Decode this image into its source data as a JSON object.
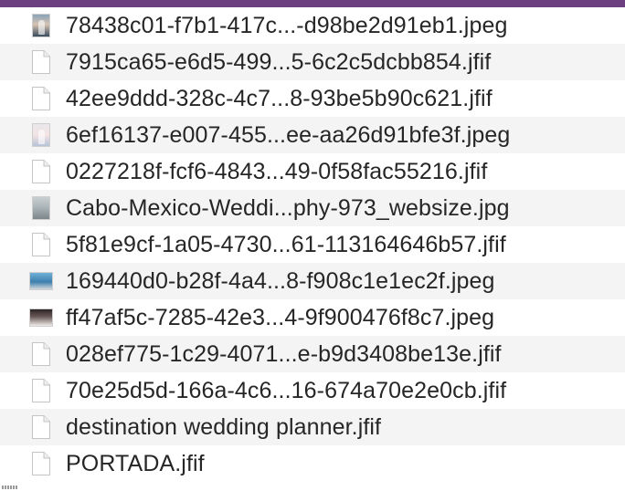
{
  "files": [
    {
      "name": "78438c01-f7b1-417c...-d98be2d91eb1.jpeg",
      "icon": "image-thumbnail-icon",
      "thumb": "t1",
      "alt": false
    },
    {
      "name": "7915ca65-e6d5-499...5-6c2c5dcbb854.jfif",
      "icon": "document-icon",
      "alt": true
    },
    {
      "name": "42ee9ddd-328c-4c7...8-93be5b90c621.jfif",
      "icon": "document-icon",
      "alt": false
    },
    {
      "name": "6ef16137-e007-455...ee-aa26d91bfe3f.jpeg",
      "icon": "image-thumbnail-icon",
      "thumb": "t2",
      "alt": true
    },
    {
      "name": "0227218f-fcf6-4843...49-0f58fac55216.jfif",
      "icon": "document-icon",
      "alt": false
    },
    {
      "name": "Cabo-Mexico-Weddi...phy-973_websize.jpg",
      "icon": "image-thumbnail-icon",
      "thumb": "t3",
      "alt": true
    },
    {
      "name": "5f81e9cf-1a05-4730...61-113164646b57.jfif",
      "icon": "document-icon",
      "alt": false
    },
    {
      "name": "169440d0-b28f-4a4...8-f908c1e1ec2f.jpeg",
      "icon": "image-thumbnail-icon",
      "thumb": "t4",
      "wide": true,
      "alt": true
    },
    {
      "name": "ff47af5c-7285-42e3...4-9f900476f8c7.jpeg",
      "icon": "image-thumbnail-icon",
      "thumb": "t5",
      "wide": true,
      "alt": false
    },
    {
      "name": "028ef775-1c29-4071...e-b9d3408be13e.jfif",
      "icon": "document-icon",
      "alt": true
    },
    {
      "name": "70e25d5d-166a-4c6...16-674a70e2e0cb.jfif",
      "icon": "document-icon",
      "alt": false
    },
    {
      "name": "destination wedding planner.jfif",
      "icon": "document-icon",
      "alt": true
    },
    {
      "name": "PORTADA.jfif",
      "icon": "document-icon",
      "alt": false
    }
  ],
  "colors": {
    "accent_bar": "#6b3f80",
    "alt_row": "#f4f4f5",
    "text": "#262626"
  }
}
